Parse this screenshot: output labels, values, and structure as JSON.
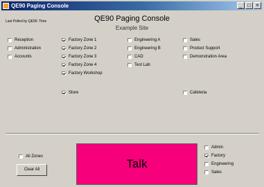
{
  "window": {
    "title": "QE90 Paging Console",
    "buttons": {
      "minimize": "_",
      "maximize": "□",
      "close": "×"
    }
  },
  "status_text": "Last Polled by QE90: Time",
  "heading": "QE90 Paging Console",
  "site": "Example Site",
  "zones": [
    {
      "label": "Reception",
      "checked": false
    },
    {
      "label": "Administration",
      "checked": false
    },
    {
      "label": "Accounts",
      "checked": false
    },
    {
      "label": "Factory Zone 1",
      "checked": true
    },
    {
      "label": "Factory Zone 2",
      "checked": true
    },
    {
      "label": "Factory Zone 3",
      "checked": true
    },
    {
      "label": "Factory Zone 4",
      "checked": true
    },
    {
      "label": "Factory Workshop",
      "checked": true
    },
    {
      "label": "Store",
      "checked": true
    },
    {
      "label": "Engineering A",
      "checked": false
    },
    {
      "label": "Engineering B",
      "checked": false
    },
    {
      "label": "CAD",
      "checked": false
    },
    {
      "label": "Test Lab",
      "checked": false
    },
    {
      "label": "Sales",
      "checked": false
    },
    {
      "label": "Product Support",
      "checked": false
    },
    {
      "label": "Demonstration Area",
      "checked": false
    },
    {
      "label": "Cafeteria",
      "checked": false
    }
  ],
  "all_zones": {
    "label": "All Zones",
    "checked": false
  },
  "clear_all_label": "Clear All",
  "talk_label": "Talk",
  "groups": [
    {
      "label": "Admin",
      "checked": false
    },
    {
      "label": "Factory",
      "checked": true
    },
    {
      "label": "Engineering",
      "checked": false
    },
    {
      "label": "Sales",
      "checked": false
    }
  ]
}
